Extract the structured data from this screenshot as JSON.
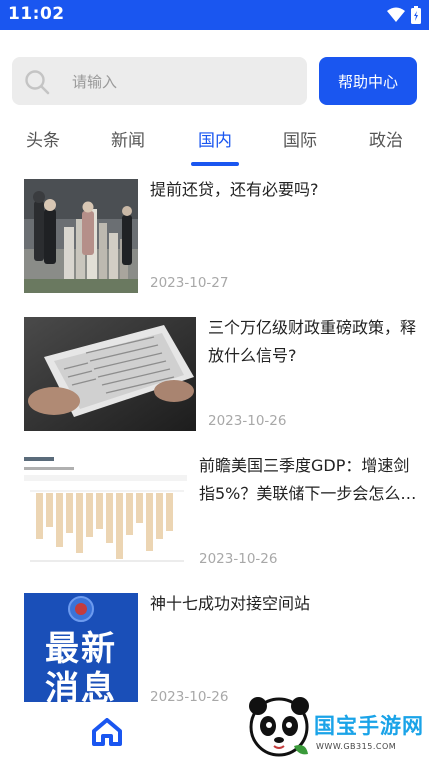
{
  "status_bar": {
    "time": "11:02",
    "icons": [
      "wifi-icon",
      "battery-icon"
    ]
  },
  "search": {
    "placeholder": "请输入",
    "value": "",
    "help_button_label": "帮助中心"
  },
  "tabs": [
    {
      "label": "头条",
      "active": false
    },
    {
      "label": "新闻",
      "active": false
    },
    {
      "label": "国内",
      "active": true
    },
    {
      "label": "国际",
      "active": false
    },
    {
      "label": "政治",
      "active": false
    }
  ],
  "news": [
    {
      "title": "提前还贷，还有必要吗?",
      "date": "2023-10-27",
      "thumb": "real-estate-model-photo"
    },
    {
      "title": "三个万亿级财政重磅政策，释放什么信号?",
      "date": "2023-10-26",
      "thumb": "newspaper-photo"
    },
    {
      "title": "前瞻美国三季度GDP：增速剑指5%？美联储下一步会怎么…",
      "date": "2023-10-26",
      "thumb": "gdp-bar-chart-screenshot"
    },
    {
      "title": "神十七成功对接空间站",
      "date": "2023-10-26",
      "thumb": "breaking-news-card"
    }
  ],
  "thumb_texts": {
    "breaking_news_line1": "最新",
    "breaking_news_line2": "消息"
  },
  "bottom_nav": {
    "items": [
      {
        "name": "home",
        "icon": "home-icon",
        "active": true
      }
    ]
  },
  "watermark": {
    "brand": "国宝手游网",
    "url": "WWW.GB315.COM"
  },
  "colors": {
    "accent": "#1a56f0",
    "date_gray": "#a8a8a8",
    "search_bg": "#ececec"
  }
}
